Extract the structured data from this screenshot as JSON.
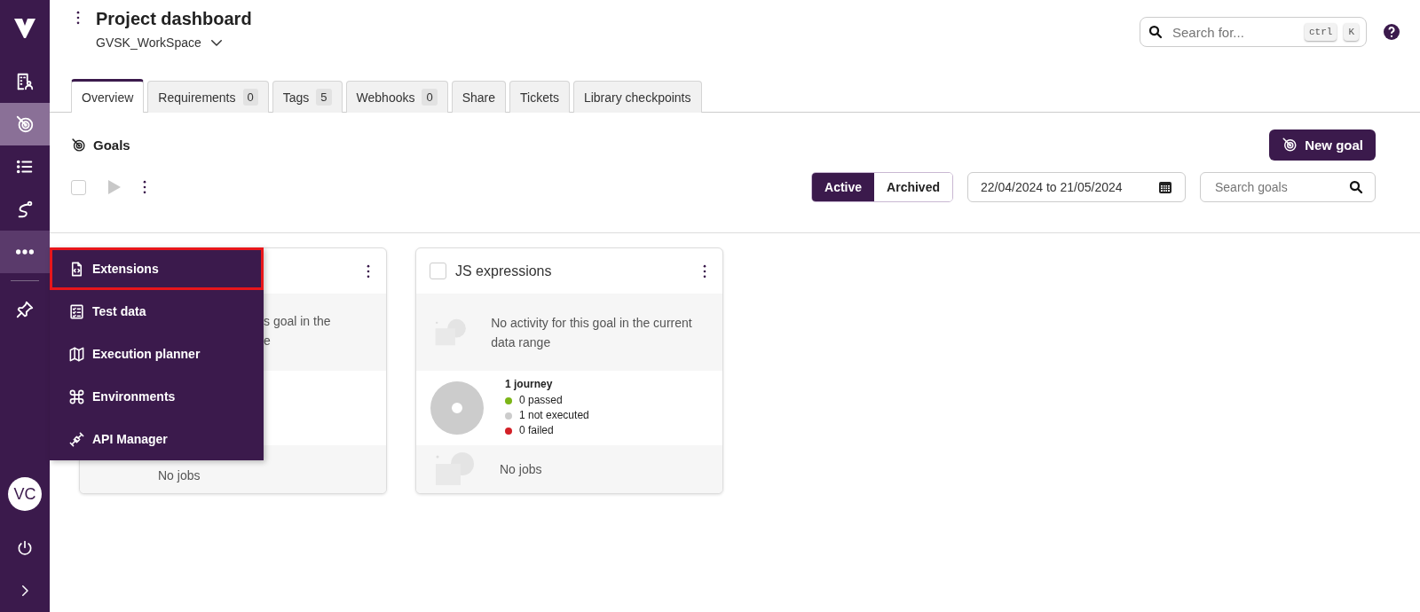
{
  "sidebar": {
    "items": [
      {
        "kind": "building",
        "selected": false
      },
      {
        "kind": "target",
        "selected": true
      },
      {
        "kind": "list",
        "selected": false
      },
      {
        "kind": "route",
        "selected": false
      },
      {
        "kind": "more",
        "selected": true
      },
      {
        "kind": "pin",
        "selected": false
      }
    ],
    "avatar": {
      "initials": "VC"
    }
  },
  "header": {
    "title": "Project dashboard",
    "workspace": "GVSK_WorkSpace",
    "search": {
      "placeholder": "Search for...",
      "keys": [
        "ctrl",
        "K"
      ]
    }
  },
  "tabs": [
    {
      "label": "Overview",
      "selected": true
    },
    {
      "label": "Requirements",
      "count": "0",
      "selected": false
    },
    {
      "label": "Tags",
      "count": "5",
      "selected": false
    },
    {
      "label": "Webhooks",
      "count": "0",
      "selected": false
    },
    {
      "label": "Share",
      "selected": false
    },
    {
      "label": "Tickets",
      "selected": false
    },
    {
      "label": "Library checkpoints",
      "selected": false
    }
  ],
  "goals": {
    "title": "Goals",
    "select_all": {
      "checked": false
    },
    "new_button": "New goal",
    "filters": [
      {
        "label": "Active",
        "selected": true
      },
      {
        "label": "Archived",
        "selected": false
      }
    ],
    "date_range": "22/04/2024 to 21/05/2024",
    "search": {
      "placeholder": "Search goals"
    }
  },
  "cards": [
    {
      "kind": "covered",
      "activity_lines": [
        "s goal in the",
        "e"
      ],
      "jobs": "No jobs"
    },
    {
      "kind": "full",
      "title": "JS expressions",
      "checked": false,
      "activity": "No activity for this goal in the current data range",
      "journeys": "1 journey",
      "legend": [
        {
          "label": "0 passed",
          "color": "#7cb518"
        },
        {
          "label": "1 not executed",
          "color": "#cccccc"
        },
        {
          "label": "0 failed",
          "color": "#d32027"
        }
      ],
      "jobs": "No jobs"
    }
  ],
  "menu": {
    "items": [
      {
        "kind": "file-code",
        "label": "Extensions",
        "selected": true
      },
      {
        "kind": "checklist",
        "label": "Test data",
        "selected": false
      },
      {
        "kind": "map",
        "label": "Execution planner",
        "selected": false
      },
      {
        "kind": "command",
        "label": "Environments",
        "selected": false
      },
      {
        "kind": "plug",
        "label": "API Manager",
        "selected": false
      }
    ]
  }
}
